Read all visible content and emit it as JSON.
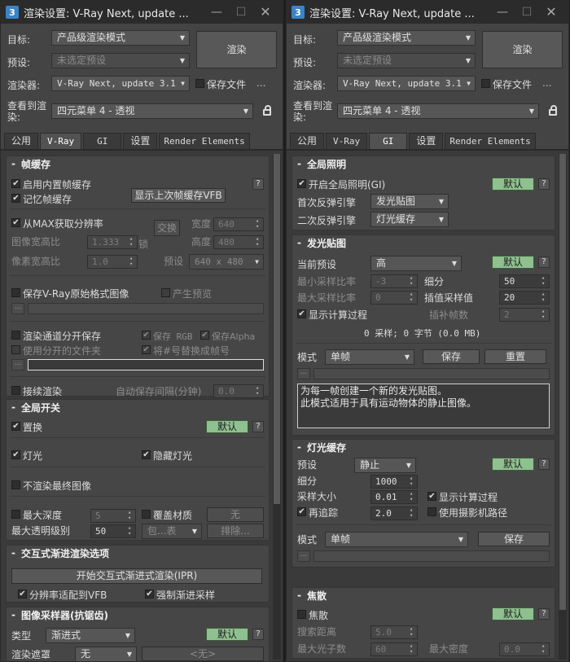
{
  "left": {
    "title": "渲染设置: V-Ray Next, update ...",
    "target_label": "目标:",
    "target_value": "产品级渲染模式",
    "preset_label": "预设:",
    "preset_value": "未选定预设",
    "renderer_label": "渲染器:",
    "renderer_value": "V-Ray Next, update 3.1",
    "save_file": "保存文件",
    "dots": "...",
    "render_button": "渲染",
    "view_label": "查看到渲染:",
    "view_value": "四元菜单 4 - 透视",
    "tabs": [
      "公用",
      "V-Ray",
      "GI",
      "设置",
      "Render Elements"
    ],
    "frame_buffer": {
      "title": "帧缓存",
      "enable_builtin": "启用内置帧缓存",
      "memory_fb": "记忆帧缓存",
      "show_last": "显示上次帧缓存VFB",
      "get_res_from_max": "从MAX获取分辨率",
      "swap": "交换",
      "width_label": "宽度",
      "width_value": "640",
      "aspect_label": "图像宽高比",
      "aspect_value": "1.333",
      "lock": "锁",
      "height_label": "高度",
      "height_value": "480",
      "pixel_aspect_label": "像素宽高比",
      "pixel_aspect_value": "1.0",
      "preset_label": "预设",
      "preset_value": "640 x 480",
      "save_raw": "保存V-Ray原始格式图像",
      "gen_preview": "产生预览",
      "dotbtn": "...",
      "split_channels": "渲染通道分开保存",
      "save_rgb": "保存 RGB",
      "save_alpha": "保存Alpha",
      "separate_folders": "使用分开的文件夹",
      "replace_hash": "将#号替换成帧号",
      "seq_render": "接续渲染",
      "autosave_label": "自动保存间隔(分钟)",
      "autosave_value": "0.0"
    },
    "global_switches": {
      "title": "全局开关",
      "displacement": "置换",
      "default": "默认",
      "lights": "灯光",
      "hidden_lights": "隐藏灯光",
      "dont_render_final": "不渲染最终图像",
      "max_depth_label": "最大深度",
      "max_depth_value": "5",
      "override_mtl": "覆盖材质",
      "none_btn": "无",
      "max_transp_label": "最大透明级别",
      "max_transp_value": "50",
      "include_dd": "包...表",
      "exclude_btn": "排除..."
    },
    "ipr": {
      "title": "交互式渐进渲染选项",
      "start_btn": "开始交互式渐进式渲染(IPR)",
      "fit_res": "分辨率适配到VFB",
      "force_prog": "强制渐进采样"
    },
    "sampler": {
      "title": "图像采样器(抗锯齿)",
      "type_label": "类型",
      "type_value": "渐进式",
      "default": "默认",
      "mask_label": "渲染遮罩",
      "mask_value": "无",
      "mask_btn": "<无>"
    },
    "help": "?"
  },
  "right": {
    "title": "渲染设置: V-Ray Next, update ...",
    "target_label": "目标:",
    "target_value": "产品级渲染模式",
    "preset_label": "预设:",
    "preset_value": "未选定预设",
    "renderer_label": "渲染器:",
    "renderer_value": "V-Ray Next, update 3.1",
    "save_file": "保存文件",
    "dots": "...",
    "render_button": "渲染",
    "view_label": "查看到渲染:",
    "view_value": "四元菜单 4 - 透视",
    "tabs": [
      "公用",
      "V-Ray",
      "GI",
      "设置",
      "Render Elements"
    ],
    "gi": {
      "title": "全局照明",
      "enable": "开启全局照明(GI)",
      "default": "默认",
      "primary_label": "首次反弹引擎",
      "primary_value": "发光贴图",
      "secondary_label": "二次反弹引擎",
      "secondary_value": "灯光缓存"
    },
    "irradiance": {
      "title": "发光贴图",
      "preset_label": "当前预设",
      "preset_value": "高",
      "default": "默认",
      "min_rate_label": "最小采样比率",
      "min_rate_value": "-3",
      "subdivs_label": "细分",
      "subdivs_value": "50",
      "max_rate_label": "最大采样比率",
      "max_rate_value": "0",
      "interp_label": "插值采样值",
      "interp_value": "20",
      "show_calc": "显示计算过程",
      "interp_frames_label": "插补帧数",
      "interp_frames_value": "2",
      "stats": "0 采样; 0 字节 (0.0 MB)",
      "mode_label": "模式",
      "mode_value": "单帧",
      "save_btn": "保存",
      "reset_btn": "重置",
      "dotbtn": "...",
      "desc_line1": "为每一帧创建一个新的发光贴图。",
      "desc_line2": "此模式适用于具有运动物体的静止图像。"
    },
    "light_cache": {
      "title": "灯光缓存",
      "preset_label": "预设",
      "preset_value": "静止",
      "default": "默认",
      "subdivs_label": "细分",
      "subdivs_value": "1000",
      "sample_size_label": "采样大小",
      "sample_size_value": "0.01",
      "show_calc": "显示计算过程",
      "retrace": "再追踪",
      "retrace_value": "2.0",
      "use_camera_path": "使用摄影机路径",
      "mode_label": "模式",
      "mode_value": "单帧",
      "save_btn": "保存",
      "dotbtn": "..."
    },
    "caustics": {
      "title": "焦散",
      "enable": "焦散",
      "default": "默认",
      "search_label": "搜索距离",
      "search_value": "5.0",
      "max_photons_label": "最大光子数",
      "max_photons_value": "60",
      "max_density_label": "最大密度",
      "max_density_value": "0.0"
    },
    "help": "?"
  },
  "colors": {
    "default_button": "#8fc08f",
    "panel": "#464646",
    "titlebar": "#2b2b2b"
  }
}
